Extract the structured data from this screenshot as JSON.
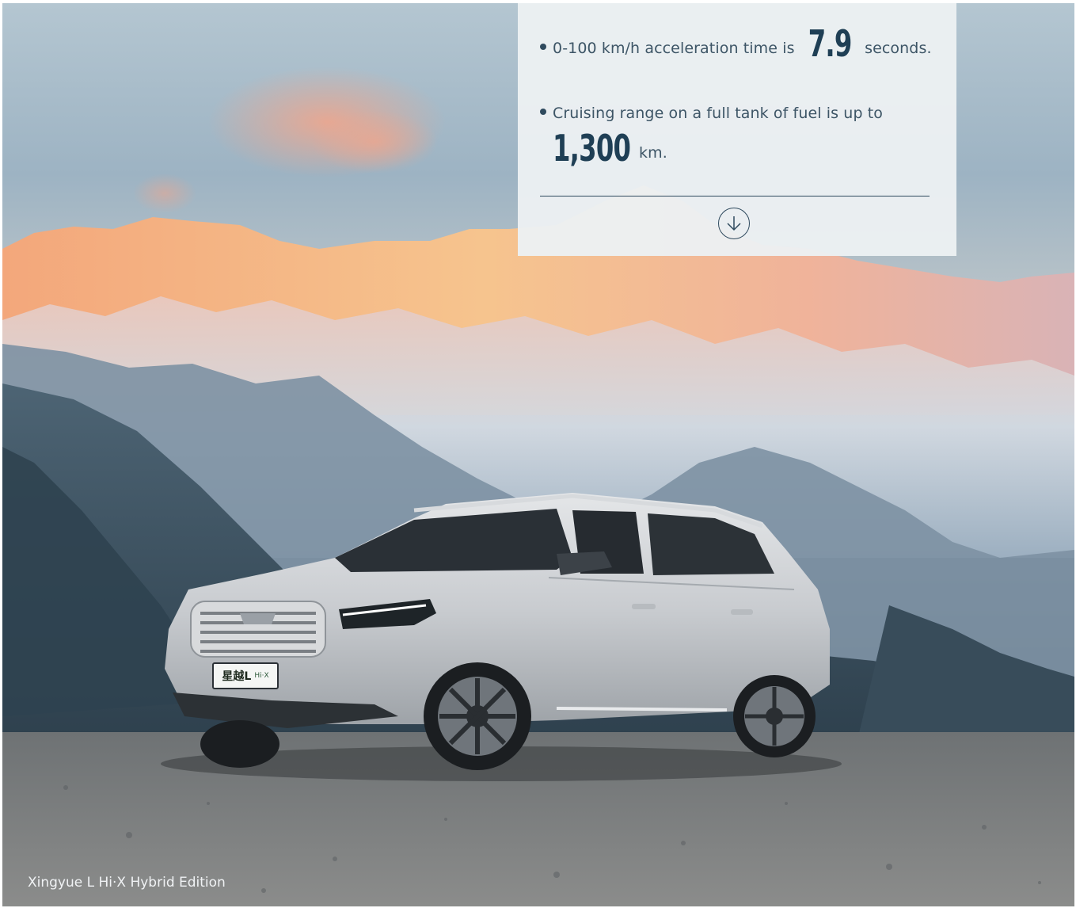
{
  "features": [
    {
      "prefix": "0-100 km/h acceleration time is",
      "value": "7.9",
      "suffix": "seconds."
    },
    {
      "prefix": "Cruising range on a full tank of fuel is up to",
      "value": "1,300",
      "suffix": "km."
    }
  ],
  "scroll_icon": "arrow-down-circle-icon",
  "plate": {
    "model": "星越L",
    "badge": "Hi·X"
  },
  "caption": "Xingyue L Hi·X Hybrid Edition",
  "colors": {
    "accent": "#2f4a5e",
    "card_bg": "#eef1f3",
    "caption": "#f0f2f4"
  }
}
